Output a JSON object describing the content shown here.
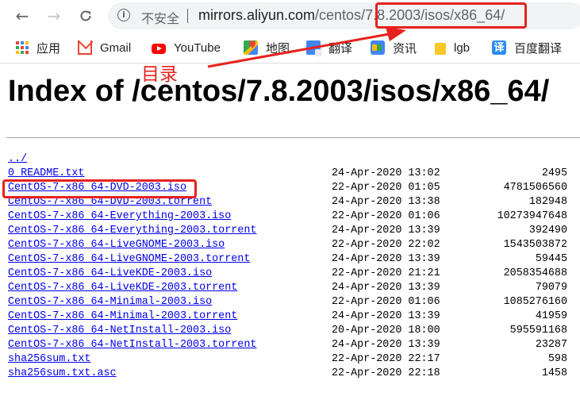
{
  "browser": {
    "security_label": "不安全",
    "url_host": "mirrors.aliyun.com",
    "url_path_prefix": "/centos/",
    "url_path_highlight": "7.8.2003/isos/x86_64/"
  },
  "bookmarks": [
    {
      "label": "应用",
      "icon": "apps-icon"
    },
    {
      "label": "Gmail",
      "icon": "gmail-icon"
    },
    {
      "label": "YouTube",
      "icon": "youtube-icon"
    },
    {
      "label": "地图",
      "icon": "maps-icon"
    },
    {
      "label": "翻译",
      "icon": "translate-icon"
    },
    {
      "label": "资讯",
      "icon": "news-icon"
    },
    {
      "label": "lgb",
      "icon": "folder-icon"
    },
    {
      "label": "百度翻译",
      "icon": "baidu-translate-icon",
      "icon_glyph": "译"
    }
  ],
  "annotation": {
    "label": "目录",
    "color": "#e6221d"
  },
  "page": {
    "heading": "Index of /centos/7.8.2003/isos/x86_64/"
  },
  "listing": [
    {
      "name": "../",
      "date": "",
      "size": ""
    },
    {
      "name": "0_README.txt",
      "date": "24-Apr-2020 13:02",
      "size": "2495"
    },
    {
      "name": "CentOS-7-x86_64-DVD-2003.iso",
      "date": "22-Apr-2020 01:05",
      "size": "4781506560"
    },
    {
      "name": "CentOS-7-x86_64-DVD-2003.torrent",
      "date": "24-Apr-2020 13:38",
      "size": "182948"
    },
    {
      "name": "CentOS-7-x86_64-Everything-2003.iso",
      "date": "22-Apr-2020 01:06",
      "size": "10273947648"
    },
    {
      "name": "CentOS-7-x86_64-Everything-2003.torrent",
      "date": "24-Apr-2020 13:39",
      "size": "392490"
    },
    {
      "name": "CentOS-7-x86_64-LiveGNOME-2003.iso",
      "date": "22-Apr-2020 22:02",
      "size": "1543503872"
    },
    {
      "name": "CentOS-7-x86_64-LiveGNOME-2003.torrent",
      "date": "24-Apr-2020 13:39",
      "size": "59445"
    },
    {
      "name": "CentOS-7-x86_64-LiveKDE-2003.iso",
      "date": "22-Apr-2020 21:21",
      "size": "2058354688"
    },
    {
      "name": "CentOS-7-x86_64-LiveKDE-2003.torrent",
      "date": "24-Apr-2020 13:39",
      "size": "79079"
    },
    {
      "name": "CentOS-7-x86_64-Minimal-2003.iso",
      "date": "22-Apr-2020 01:06",
      "size": "1085276160"
    },
    {
      "name": "CentOS-7-x86_64-Minimal-2003.torrent",
      "date": "24-Apr-2020 13:39",
      "size": "41959"
    },
    {
      "name": "CentOS-7-x86_64-NetInstall-2003.iso",
      "date": "20-Apr-2020 18:00",
      "size": "595591168"
    },
    {
      "name": "CentOS-7-x86_64-NetInstall-2003.torrent",
      "date": "24-Apr-2020 13:39",
      "size": "23287"
    },
    {
      "name": "sha256sum.txt",
      "date": "22-Apr-2020 22:17",
      "size": "598"
    },
    {
      "name": "sha256sum.txt.asc",
      "date": "22-Apr-2020 22:18",
      "size": "1458"
    }
  ]
}
